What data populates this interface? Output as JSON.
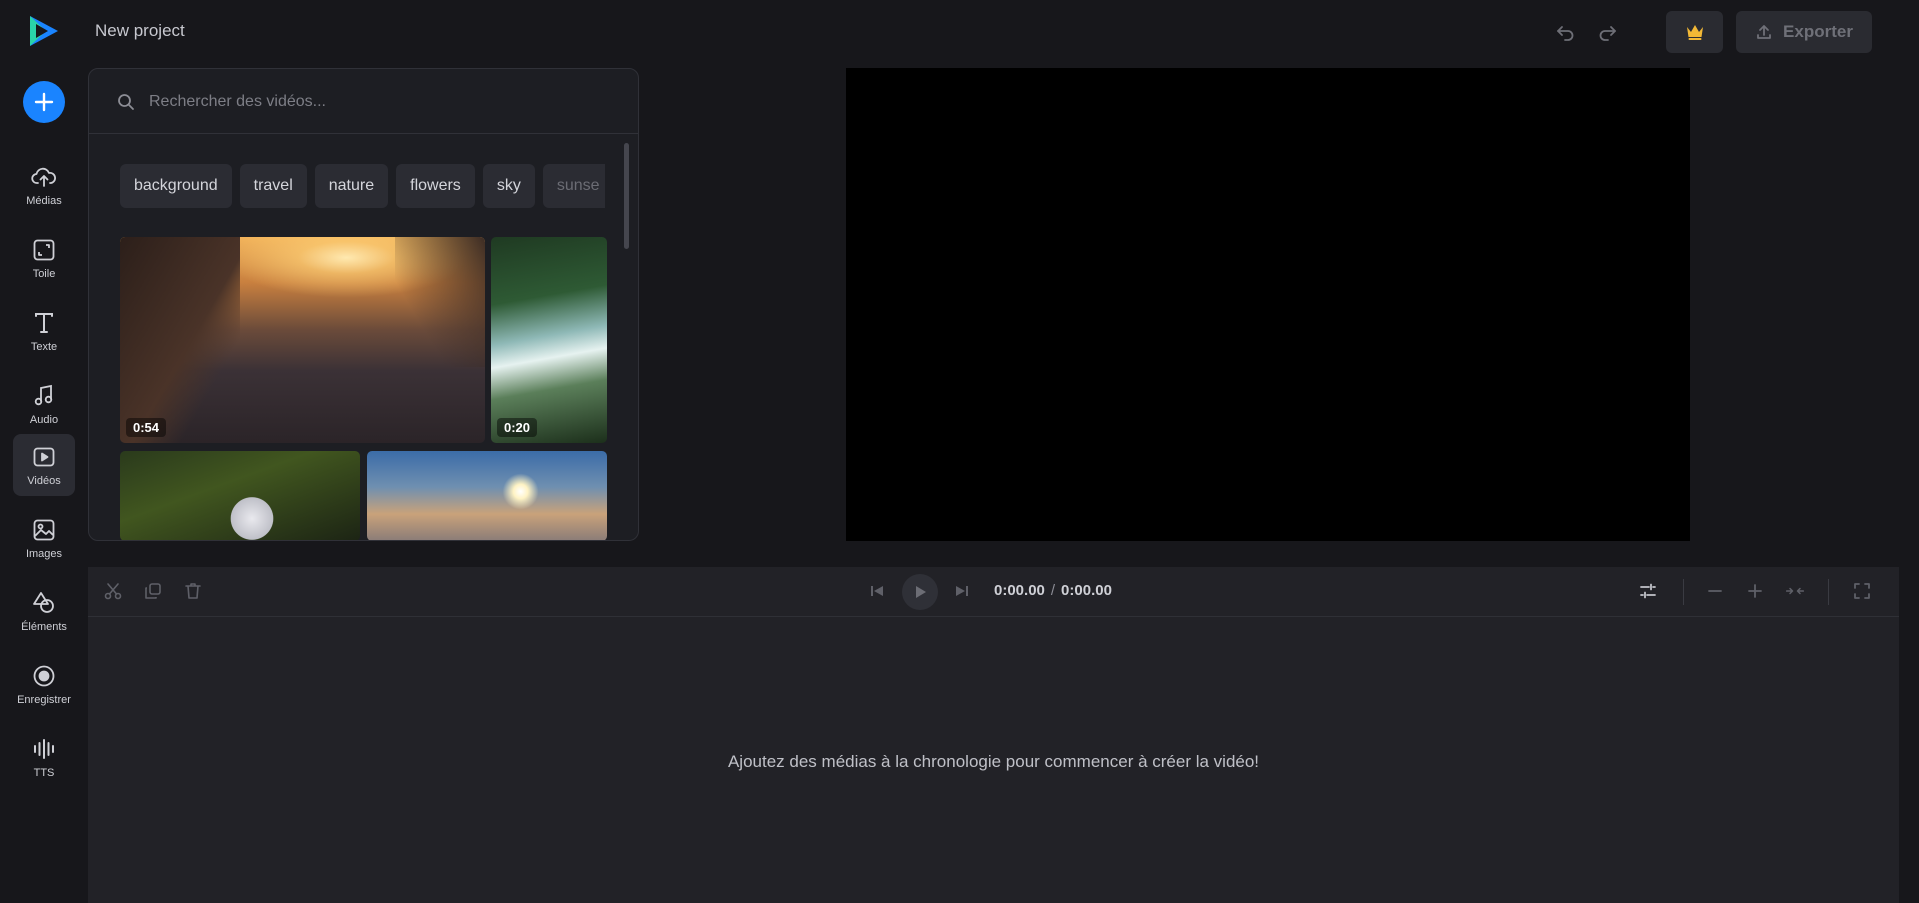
{
  "project": {
    "title": "New project"
  },
  "colors": {
    "accent": "#1a84ff",
    "background": "#17171b",
    "panel": "#1d1e23",
    "crown": "#f2b836"
  },
  "sidebar": {
    "items": [
      {
        "label": "Médias",
        "icon": "upload-cloud-icon"
      },
      {
        "label": "Toile",
        "icon": "canvas-icon"
      },
      {
        "label": "Texte",
        "icon": "text-icon"
      },
      {
        "label": "Audio",
        "icon": "music-note-icon"
      },
      {
        "label": "Vidéos",
        "icon": "video-play-icon",
        "active": true
      },
      {
        "label": "Images",
        "icon": "image-icon"
      },
      {
        "label": "Éléments",
        "icon": "shapes-icon"
      },
      {
        "label": "Enregistrer",
        "icon": "record-icon"
      },
      {
        "label": "TTS",
        "icon": "waveform-icon"
      }
    ]
  },
  "header": {
    "export_label": "Exporter"
  },
  "search": {
    "placeholder": "Rechercher des vidéos..."
  },
  "chips": [
    "background",
    "travel",
    "nature",
    "flowers",
    "sky",
    "sunse"
  ],
  "videos": [
    {
      "duration": "0:54"
    },
    {
      "duration": "0:20"
    },
    {
      "duration": ""
    },
    {
      "duration": ""
    }
  ],
  "timeline": {
    "current_time": "0:00.00",
    "separator": "/",
    "total_time": "0:00.00",
    "empty_message": "Ajoutez des médias à la chronologie pour commencer à créer la vidéo!"
  }
}
